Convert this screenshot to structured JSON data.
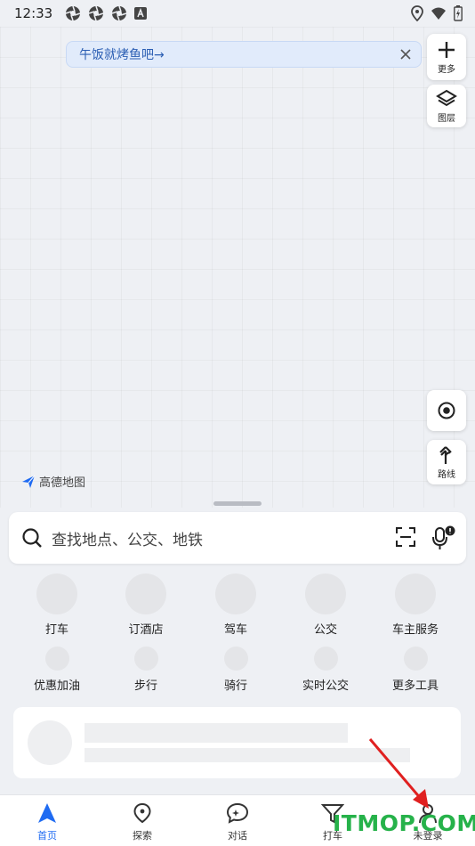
{
  "status_bar": {
    "time": "12:33"
  },
  "banner": {
    "text": "午饭就烤鱼吧→"
  },
  "map_controls": {
    "more_label": "更多",
    "layers_label": "图层",
    "route_label": "路线"
  },
  "logo": {
    "text": "高德地图"
  },
  "search": {
    "placeholder": "查找地点、公交、地铁"
  },
  "shortcuts": {
    "row1": [
      {
        "label": "打车"
      },
      {
        "label": "订酒店"
      },
      {
        "label": "驾车"
      },
      {
        "label": "公交"
      },
      {
        "label": "车主服务"
      }
    ],
    "row2": [
      {
        "label": "优惠加油"
      },
      {
        "label": "步行"
      },
      {
        "label": "骑行"
      },
      {
        "label": "实时公交"
      },
      {
        "label": "更多工具"
      }
    ]
  },
  "bottom_nav": {
    "items": [
      {
        "label": "首页"
      },
      {
        "label": "探索"
      },
      {
        "label": "对话"
      },
      {
        "label": "打车"
      },
      {
        "label": "未登录"
      }
    ]
  },
  "watermark": {
    "text": "ITMOP.COM"
  },
  "colors": {
    "accent": "#1f6bf2",
    "banner_bg": "#e1ebfb",
    "watermark": "#26b24a",
    "arrow": "#e02020"
  }
}
